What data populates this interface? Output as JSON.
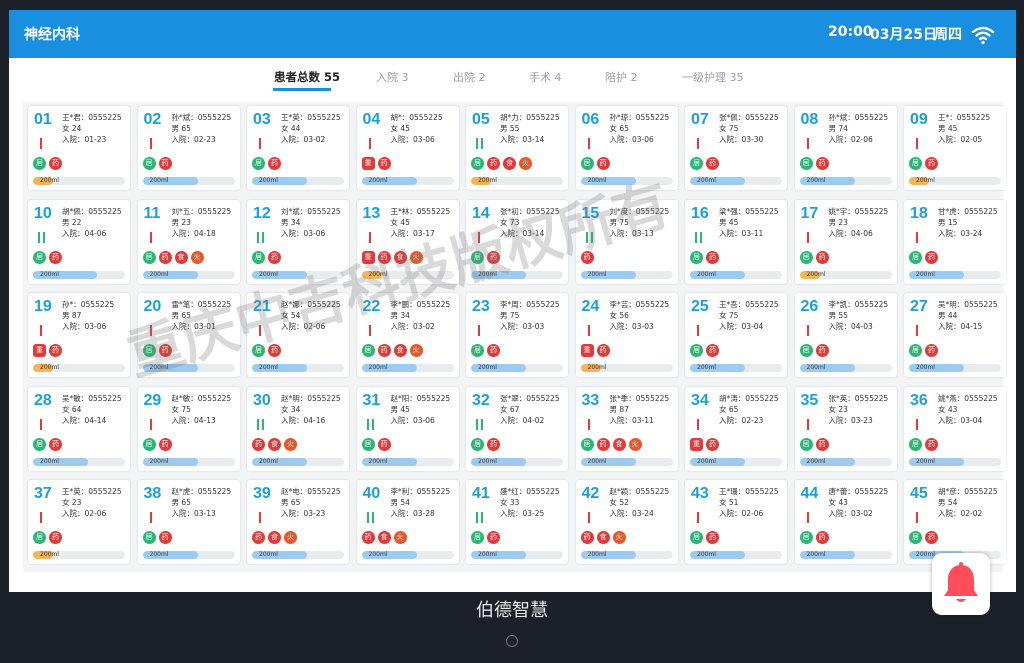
{
  "header": {
    "title": "神经内科",
    "time": "20:00",
    "date": "03月25日",
    "weekday": "周四"
  },
  "tabs": [
    {
      "label": "患者总数 55",
      "active": true
    },
    {
      "label": "入院 3"
    },
    {
      "label": "出院 2"
    },
    {
      "label": "手术 4"
    },
    {
      "label": "陪护 2"
    },
    {
      "label": "一级护理 35"
    }
  ],
  "watermark": "重庆中吉科技版权所有",
  "brand": "伯德智慧",
  "colors": {
    "header": "#1a8fe0",
    "bed_number": "#1aa0d8",
    "bar_blue": "#9ccbf2",
    "bar_orange": "#f5b45a"
  },
  "beds": [
    {
      "num": "01",
      "name": "王*君：0555225",
      "sa": "女 24",
      "admit": "入院：01-23",
      "mark": "red",
      "icons": [
        "居",
        "药"
      ],
      "bar": "200ml",
      "bar_color": "orange",
      "fill": 0.22
    },
    {
      "num": "02",
      "name": "孙*斌：0555225",
      "sa": "男 65",
      "admit": "入院：02-23",
      "mark": "red",
      "icons": [
        "居",
        "药"
      ],
      "bar": "200ml",
      "bar_color": "blue",
      "fill": 0.6
    },
    {
      "num": "03",
      "name": "王*英：0555225",
      "sa": "女 44",
      "admit": "入院：03-02",
      "mark": "red",
      "icons": [
        "居",
        "药"
      ],
      "bar": "200ml",
      "bar_color": "blue",
      "fill": 0.6
    },
    {
      "num": "04",
      "name": "胡*：0555225",
      "sa": "女 45",
      "admit": "入院：03-06",
      "mark": "red",
      "icons": [
        "重",
        "药"
      ],
      "bar": "200ml",
      "bar_color": "blue",
      "fill": 0.6
    },
    {
      "num": "05",
      "name": "胡*力：0555225",
      "sa": "男 55",
      "admit": "入院：03-14",
      "mark": "green",
      "icons": [
        "居",
        "药",
        "食",
        "火"
      ],
      "bar": "200ml",
      "bar_color": "orange",
      "fill": 0.22
    },
    {
      "num": "06",
      "name": "孙*琼：0555225",
      "sa": "女 65",
      "admit": "入院：03-06",
      "mark": "red",
      "icons": [
        "居",
        "药"
      ],
      "bar": "200ml",
      "bar_color": "blue",
      "fill": 0.6
    },
    {
      "num": "07",
      "name": "张*佩：0555225",
      "sa": "女 75",
      "admit": "入院：03-30",
      "mark": "red",
      "icons": [
        "居",
        "药"
      ],
      "bar": "200ml",
      "bar_color": "blue",
      "fill": 0.6
    },
    {
      "num": "08",
      "name": "孙*斌：0555225",
      "sa": "男 74",
      "admit": "入院：02-06",
      "mark": "red",
      "icons": [
        "居",
        "药"
      ],
      "bar": "200ml",
      "bar_color": "blue",
      "fill": 0.6
    },
    {
      "num": "09",
      "name": "王*：0555225",
      "sa": "男 45",
      "admit": "入院：02-05",
      "mark": "red",
      "icons": [
        "居",
        "药"
      ],
      "bar": "200ml",
      "bar_color": "orange",
      "fill": 0.22
    },
    {
      "num": "10",
      "name": "胡*佩：0555225",
      "sa": "男 22",
      "admit": "入院：04-06",
      "mark": "green",
      "icons": [
        "居",
        "药"
      ],
      "bar": "200ml",
      "bar_color": "blue",
      "fill": 0.7
    },
    {
      "num": "11",
      "name": "刘*五：0555225",
      "sa": "男 23",
      "admit": "入院：04-18",
      "mark": "red",
      "icons": [
        "居",
        "药",
        "食",
        "火"
      ],
      "bar": "200ml",
      "bar_color": "blue",
      "fill": 0.6
    },
    {
      "num": "12",
      "name": "刘*斌：0555225",
      "sa": "男 34",
      "admit": "入院：03-06",
      "mark": "green",
      "icons": [
        "居",
        "药"
      ],
      "bar": "200ml",
      "bar_color": "blue",
      "fill": 0.6
    },
    {
      "num": "13",
      "name": "王*林：0555225",
      "sa": "女 45",
      "admit": "入院：03-17",
      "mark": "red",
      "icons": [
        "重",
        "药",
        "食",
        "火"
      ],
      "bar": "200ml",
      "bar_color": "orange",
      "fill": 0.22
    },
    {
      "num": "14",
      "name": "张*初：0555225",
      "sa": "女 73",
      "admit": "入院：03-14",
      "mark": "red",
      "icons": [
        "居",
        "药"
      ],
      "bar": "200ml",
      "bar_color": "blue",
      "fill": 0.6
    },
    {
      "num": "15",
      "name": "刘*度：0555225",
      "sa": "男 75",
      "admit": "入院：03-13",
      "mark": "green",
      "icons": [
        "药"
      ],
      "bar": "200ml",
      "bar_color": "blue",
      "fill": 0.6
    },
    {
      "num": "16",
      "name": "梁*强：0555225",
      "sa": "男 45",
      "admit": "入院：03-11",
      "mark": "green",
      "icons": [
        "居",
        "药"
      ],
      "bar": "200ml",
      "bar_color": "blue",
      "fill": 0.6
    },
    {
      "num": "17",
      "name": "姚*宇：0555225",
      "sa": "男 23",
      "admit": "入院：04-06",
      "mark": "red",
      "icons": [
        "居",
        "药"
      ],
      "bar": "200ml",
      "bar_color": "orange",
      "fill": 0.22
    },
    {
      "num": "18",
      "name": "甘*虎：0555225",
      "sa": "男 15",
      "admit": "入院：03-24",
      "mark": "red",
      "icons": [
        "居",
        "药"
      ],
      "bar": "200ml",
      "bar_color": "blue",
      "fill": 0.6
    },
    {
      "num": "19",
      "name": "孙*：0555225",
      "sa": "男 87",
      "admit": "入院：03-06",
      "mark": "red",
      "icons": [
        "重",
        "药"
      ],
      "bar": "200ml",
      "bar_color": "orange",
      "fill": 0.22
    },
    {
      "num": "20",
      "name": "雷*笔：0555225",
      "sa": "男 65",
      "admit": "入院：03-01",
      "mark": "red",
      "icons": [
        "居",
        "药"
      ],
      "bar": "200ml",
      "bar_color": "blue",
      "fill": 0.6
    },
    {
      "num": "21",
      "name": "赵*娜：0555225",
      "sa": "女 54",
      "admit": "入院：02-06",
      "mark": "red",
      "icons": [
        "居",
        "药"
      ],
      "bar": "200ml",
      "bar_color": "blue",
      "fill": 0.6
    },
    {
      "num": "22",
      "name": "李*鹏：0555225",
      "sa": "男 34",
      "admit": "入院：03-02",
      "mark": "red",
      "icons": [
        "居",
        "药",
        "食",
        "火"
      ],
      "bar": "200ml",
      "bar_color": "blue",
      "fill": 0.6
    },
    {
      "num": "23",
      "name": "李*周：0555225",
      "sa": "男 75",
      "admit": "入院：03-03",
      "mark": "red",
      "icons": [
        "居",
        "药"
      ],
      "bar": "200ml",
      "bar_color": "blue",
      "fill": 0.6
    },
    {
      "num": "24",
      "name": "李*芸：0555225",
      "sa": "女 56",
      "admit": "入院：03-03",
      "mark": "red",
      "icons": [
        "重",
        "药"
      ],
      "bar": "200ml",
      "bar_color": "orange",
      "fill": 0.22
    },
    {
      "num": "25",
      "name": "王*吾：0555225",
      "sa": "女 75",
      "admit": "入院：03-04",
      "mark": "red",
      "icons": [
        "居",
        "药"
      ],
      "bar": "200ml",
      "bar_color": "blue",
      "fill": 0.6
    },
    {
      "num": "26",
      "name": "李*凯：0555225",
      "sa": "男 55",
      "admit": "入院：04-03",
      "mark": "red",
      "icons": [
        "居",
        "药"
      ],
      "bar": "200ml",
      "bar_color": "blue",
      "fill": 0.6
    },
    {
      "num": "27",
      "name": "吴*明：0555225",
      "sa": "男 44",
      "admit": "入院：04-15",
      "mark": "red",
      "icons": [
        "居",
        "药"
      ],
      "bar": "200ml",
      "bar_color": "blue",
      "fill": 0.6
    },
    {
      "num": "28",
      "name": "吴*敏：0555225",
      "sa": "女 64",
      "admit": "入院：04-14",
      "mark": "red",
      "icons": [
        "居",
        "药"
      ],
      "bar": "200ml",
      "bar_color": "blue",
      "fill": 0.6
    },
    {
      "num": "29",
      "name": "赵*敏：0555225",
      "sa": "女 75",
      "admit": "入院：04-13",
      "mark": "red",
      "icons": [
        "居",
        "药"
      ],
      "bar": "200ml",
      "bar_color": "blue",
      "fill": 0.6
    },
    {
      "num": "30",
      "name": "赵*明：0555225",
      "sa": "女 34",
      "admit": "入院：04-16",
      "mark": "green",
      "icons": [
        "药",
        "食",
        "火"
      ],
      "bar": "200ml",
      "bar_color": "blue",
      "fill": 0.6
    },
    {
      "num": "31",
      "name": "赵*阳：0555225",
      "sa": "男 45",
      "admit": "入院：03-06",
      "mark": "green",
      "icons": [
        "居",
        "药"
      ],
      "bar": "200ml",
      "bar_color": "blue",
      "fill": 0.6
    },
    {
      "num": "32",
      "name": "张*翠：0555225",
      "sa": "女 67",
      "admit": "入院：04-02",
      "mark": "green",
      "icons": [
        "居",
        "药"
      ],
      "bar": "200ml",
      "bar_color": "blue",
      "fill": 0.6
    },
    {
      "num": "33",
      "name": "张*季：0555225",
      "sa": "男 87",
      "admit": "入院：03-11",
      "mark": "red",
      "icons": [
        "居",
        "药",
        "食",
        "火"
      ],
      "bar": "200ml",
      "bar_color": "blue",
      "fill": 0.6
    },
    {
      "num": "34",
      "name": "胡*涛：0555225",
      "sa": "女 65",
      "admit": "入院：02-23",
      "mark": "red",
      "icons": [
        "重",
        "药"
      ],
      "bar": "200ml",
      "bar_color": "blue",
      "fill": 0.6
    },
    {
      "num": "35",
      "name": "张*英：0555225",
      "sa": "女 23",
      "admit": "入院：03-23",
      "mark": "red",
      "icons": [
        "居",
        "药"
      ],
      "bar": "200ml",
      "bar_color": "blue",
      "fill": 0.6
    },
    {
      "num": "36",
      "name": "姚*燕：0555225",
      "sa": "女 43",
      "admit": "入院：03-04",
      "mark": "red",
      "icons": [
        "居",
        "药"
      ],
      "bar": "200ml",
      "bar_color": "blue",
      "fill": 0.6
    },
    {
      "num": "37",
      "name": "王*英：0555225",
      "sa": "女 23",
      "admit": "入院：02-06",
      "mark": "red",
      "icons": [
        "居",
        "药"
      ],
      "bar": "200ml",
      "bar_color": "orange",
      "fill": 0.22
    },
    {
      "num": "38",
      "name": "赵*虎：0555225",
      "sa": "男 65",
      "admit": "入院：03-13",
      "mark": "red",
      "icons": [
        "居",
        "药"
      ],
      "bar": "200ml",
      "bar_color": "blue",
      "fill": 0.6
    },
    {
      "num": "39",
      "name": "赵*电：0555225",
      "sa": "男 65",
      "admit": "入院：03-23",
      "mark": "red",
      "icons": [
        "药",
        "食",
        "火"
      ],
      "bar": "200ml",
      "bar_color": "blue",
      "fill": 0.6
    },
    {
      "num": "40",
      "name": "李*利：0555225",
      "sa": "男 54",
      "admit": "入院：03-28",
      "mark": "green",
      "icons": [
        "药",
        "食",
        "火"
      ],
      "bar": "200ml",
      "bar_color": "blue",
      "fill": 0.6
    },
    {
      "num": "41",
      "name": "盛*红：0555225",
      "sa": "女 33",
      "admit": "入院：03-25",
      "mark": "green",
      "icons": [
        "居",
        "药"
      ],
      "bar": "200ml",
      "bar_color": "blue",
      "fill": 0.6
    },
    {
      "num": "42",
      "name": "赵*颖：0555225",
      "sa": "女 52",
      "admit": "入院：03-24",
      "mark": "red",
      "icons": [
        "药",
        "食",
        "火"
      ],
      "bar": "200ml",
      "bar_color": "blue",
      "fill": 0.6
    },
    {
      "num": "43",
      "name": "王*珊：0555225",
      "sa": "女 51",
      "admit": "入院：02-06",
      "mark": "red",
      "icons": [
        "居",
        "药"
      ],
      "bar": "200ml",
      "bar_color": "blue",
      "fill": 0.6
    },
    {
      "num": "44",
      "name": "唐*蕾：0555225",
      "sa": "女 43",
      "admit": "入院：03-02",
      "mark": "red",
      "icons": [
        "居",
        "药"
      ],
      "bar": "200ml",
      "bar_color": "blue",
      "fill": 0.6
    },
    {
      "num": "45",
      "name": "胡*彦：0555225",
      "sa": "男 54",
      "admit": "入院：02-02",
      "mark": "red",
      "icons": [
        "居",
        "药"
      ],
      "bar": "200ml",
      "bar_color": "blue",
      "fill": 0.6
    }
  ]
}
